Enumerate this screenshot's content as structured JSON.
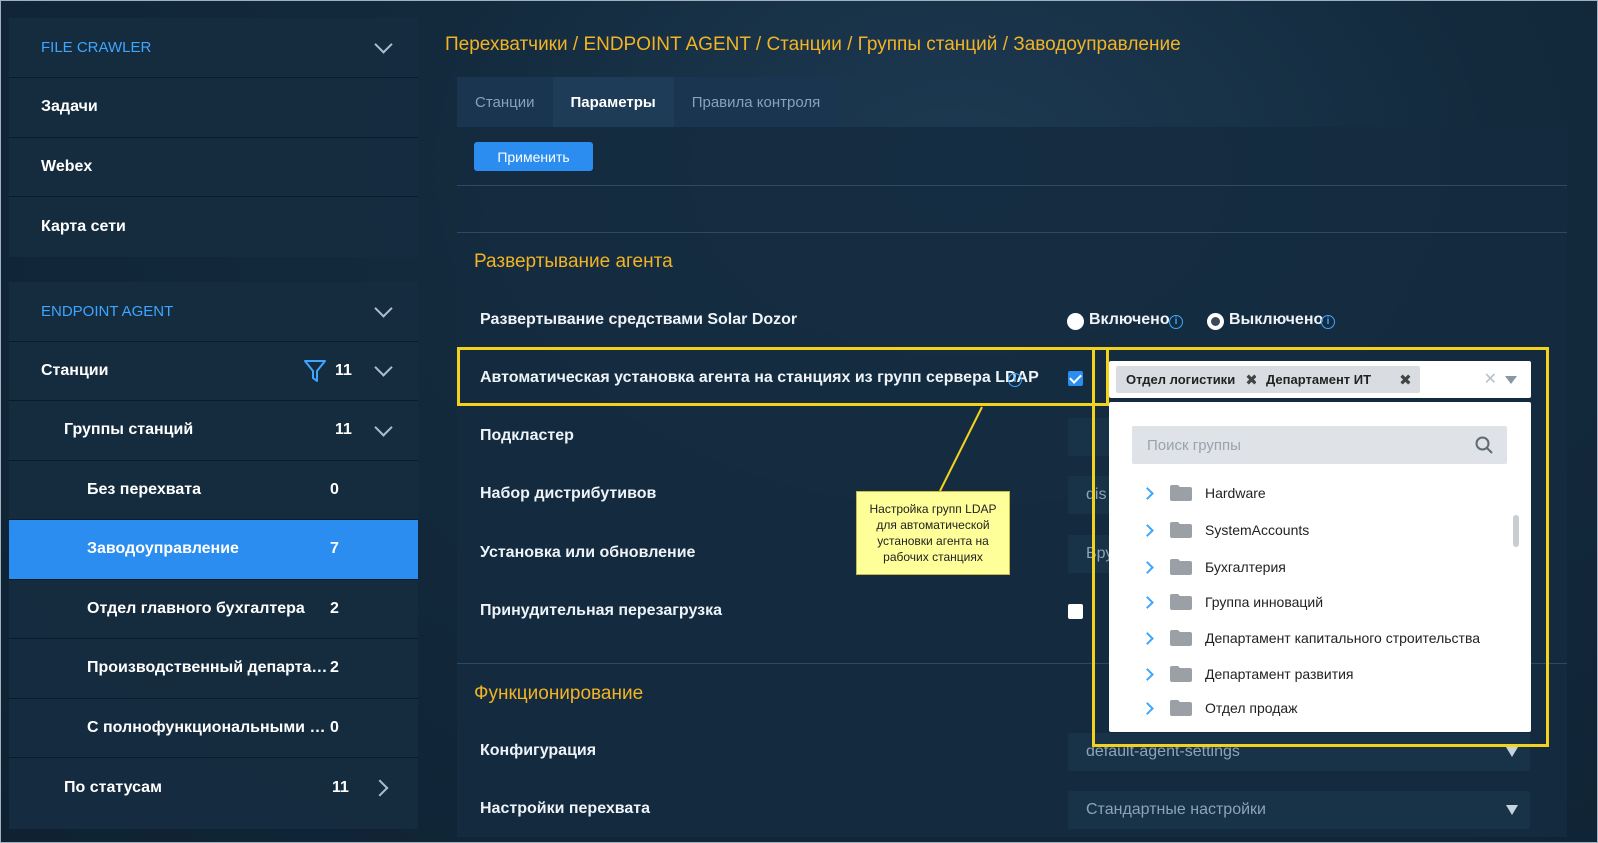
{
  "sidebar": {
    "file_crawler": {
      "title": "FILE CRAWLER",
      "items": [
        "Задачи",
        "Webex",
        "Карта сети"
      ]
    },
    "endpoint_agent": {
      "title": "ENDPOINT AGENT",
      "stations": {
        "label": "Станции",
        "count": "11"
      },
      "groups": {
        "label": "Группы станций",
        "count": "11"
      },
      "group_items": [
        {
          "label": "Без перехвата",
          "count": "0"
        },
        {
          "label": "Заводоуправление",
          "count": "7"
        },
        {
          "label": "Отдел главного бухгалтера",
          "count": "2"
        },
        {
          "label": "Производственный департам...",
          "count": "2"
        },
        {
          "label": "С полнофункциональными Еп...",
          "count": "0"
        }
      ],
      "by_status": {
        "label": "По статусам",
        "count": "11"
      }
    }
  },
  "breadcrumb": "Перехватчики / ENDPOINT AGENT / Станции / Группы станций / Заводоуправление",
  "tabs": [
    "Станции",
    "Параметры",
    "Правила контроля"
  ],
  "apply_label": "Применить",
  "deploy": {
    "title": "Развертывание агента",
    "solar_label": "Развертывание средствами Solar Dozor",
    "opt_on": "Включено",
    "opt_off": "Выключено",
    "ldap_label": "Автоматическая установка агента на станциях из групп сервера LDAP",
    "ldap_checked": true,
    "selected_groups": [
      "Отдел логистики",
      "Департамент ИТ"
    ],
    "subcluster_label": "Подкластер",
    "distrib_label": "Набор дистрибутивов",
    "distrib_value": "dis",
    "install_label": "Установка или обновление",
    "install_value": "Вру",
    "reboot_label": "Принудительная перезагрузка"
  },
  "dropdown": {
    "search_placeholder": "Поиск группы",
    "groups": [
      "Hardware",
      "SystemAccounts",
      "Бухгалтерия",
      "Группа инноваций",
      "Департамент капитального строительства",
      "Департамент развития",
      "Отдел продаж"
    ]
  },
  "functioning": {
    "title": "Функционирование",
    "config_label": "Конфигурация",
    "config_value": "default-agent-settings",
    "intercept_label": "Настройки перехвата",
    "intercept_value": "Стандартные настройки"
  },
  "callout": "Настройка групп LDAP\nдля автоматической\nустановки агента на\nрабочих станциях",
  "colors": {
    "accent": "#2b8df0",
    "highlight": "#f2d21c",
    "orange": "#f2b325",
    "link": "#3ea6ff"
  }
}
